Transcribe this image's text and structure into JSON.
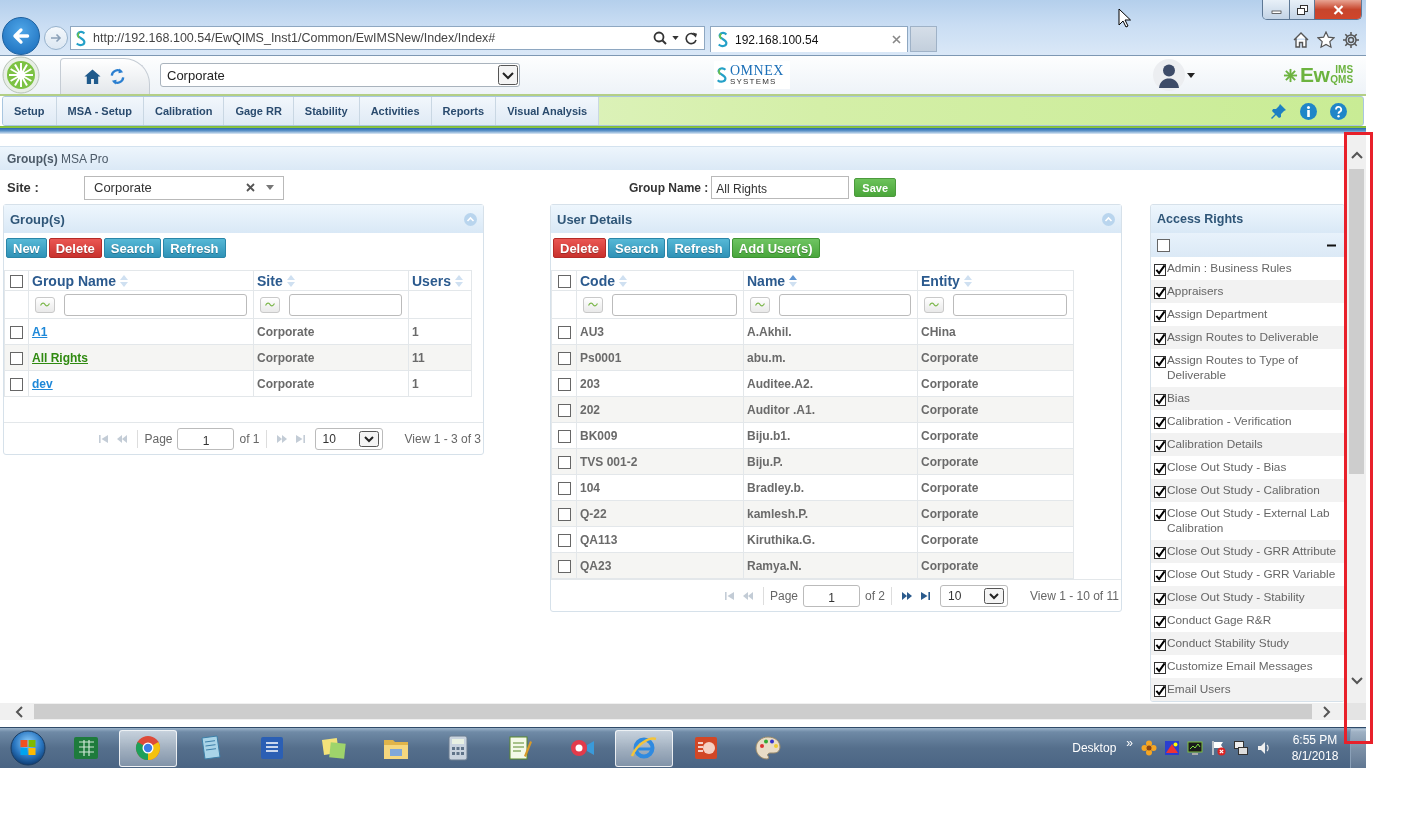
{
  "browser": {
    "url": "http://192.168.100.54/EwQIMS_Inst1/Common/EwIMSNew/Index/Index#",
    "tab_title": "192.168.100.54"
  },
  "app_header": {
    "site_select": "Corporate",
    "company_logo": {
      "name": "OMNEX",
      "tagline": "SYSTEMS"
    },
    "product_logo": {
      "main": "Ew",
      "top": "IMS",
      "bottom": "QMS"
    }
  },
  "menu": [
    "Setup",
    "MSA - Setup",
    "Calibration",
    "Gage RR",
    "Stability",
    "Activities",
    "Reports",
    "Visual Analysis"
  ],
  "page_title": "**Group(s)** MSA Pro",
  "site_filter": {
    "label": "Site :",
    "value": "Corporate"
  },
  "group_name": {
    "label": "Group Name :",
    "value": "All Rights",
    "save_button": "Save"
  },
  "groups_panel": {
    "title": "Group(s)",
    "buttons": [
      {
        "label": "New",
        "kind": "primary"
      },
      {
        "label": "Delete",
        "kind": "danger"
      },
      {
        "label": "Search",
        "kind": "primary"
      },
      {
        "label": "Refresh",
        "kind": "primary"
      }
    ],
    "all_checked": false,
    "columns": [
      {
        "label": "Group Name",
        "sorted": false,
        "filter": true
      },
      {
        "label": "Site",
        "sorted": false,
        "filter": true
      },
      {
        "label": "Users",
        "sorted": false,
        "filter": false
      }
    ],
    "rows": [
      {
        "name": "A1",
        "site": "Corporate",
        "users": "1",
        "checked": false,
        "selected": false
      },
      {
        "name": "All Rights",
        "site": "Corporate",
        "users": "11",
        "checked": false,
        "selected": true
      },
      {
        "name": "dev",
        "site": "Corporate",
        "users": "1",
        "checked": false,
        "selected": false
      }
    ],
    "pager": {
      "page_label": "Page",
      "page": "1",
      "total": "of 1",
      "page_size": "10",
      "summary": "View 1 - 3 of 3",
      "has_prev": false,
      "has_next": false
    }
  },
  "users_panel": {
    "title": "User Details",
    "buttons": [
      {
        "label": "Delete",
        "kind": "danger"
      },
      {
        "label": "Search",
        "kind": "primary"
      },
      {
        "label": "Refresh",
        "kind": "primary"
      },
      {
        "label": "Add User(s)",
        "kind": "success"
      }
    ],
    "all_checked": false,
    "columns": [
      {
        "label": "Code",
        "sorted": false,
        "filter": true
      },
      {
        "label": "Name",
        "sorted": true,
        "filter": true
      },
      {
        "label": "Entity",
        "sorted": false,
        "filter": true
      }
    ],
    "rows": [
      {
        "code": "AU3",
        "name": "A.Akhil.",
        "entity": "CHina",
        "checked": false
      },
      {
        "code": "Ps0001",
        "name": "abu.m.",
        "entity": "Corporate",
        "checked": false
      },
      {
        "code": "203",
        "name": "Auditee.A2.",
        "entity": "Corporate",
        "checked": false
      },
      {
        "code": "202",
        "name": "Auditor .A1.",
        "entity": "Corporate",
        "checked": false
      },
      {
        "code": "BK009",
        "name": "Biju.b1.",
        "entity": "Corporate",
        "checked": false
      },
      {
        "code": "TVS 001-2",
        "name": "Biju.P.",
        "entity": "Corporate",
        "checked": false
      },
      {
        "code": "104",
        "name": "Bradley.b.",
        "entity": "Corporate",
        "checked": false
      },
      {
        "code": "Q-22",
        "name": "kamlesh.P.",
        "entity": "Corporate",
        "checked": false
      },
      {
        "code": "QA113",
        "name": "Kiruthika.G.",
        "entity": "Corporate",
        "checked": false
      },
      {
        "code": "QA23",
        "name": "Ramya.N.",
        "entity": "Corporate",
        "checked": false
      }
    ],
    "pager": {
      "page_label": "Page",
      "page": "1",
      "total": "of 2",
      "page_size": "10",
      "summary": "View 1 - 10 of 11",
      "has_prev": false,
      "has_next": true
    }
  },
  "access_rights": {
    "title": "Access Rights",
    "all_checked": false,
    "expanded": true,
    "items": [
      {
        "label": "Admin : Business Rules",
        "checked": true
      },
      {
        "label": "Appraisers",
        "checked": true
      },
      {
        "label": "Assign Department",
        "checked": true
      },
      {
        "label": "Assign Routes to Deliverable",
        "checked": true
      },
      {
        "label": "Assign Routes to Type of Deliverable",
        "checked": true
      },
      {
        "label": "Bias",
        "checked": true
      },
      {
        "label": "Calibration - Verification",
        "checked": true
      },
      {
        "label": "Calibration Details",
        "checked": true
      },
      {
        "label": "Close Out Study - Bias",
        "checked": true
      },
      {
        "label": "Close Out Study - Calibration",
        "checked": true
      },
      {
        "label": "Close Out Study - External Lab Calibration",
        "checked": true
      },
      {
        "label": "Close Out Study - GRR Attribute",
        "checked": true
      },
      {
        "label": "Close Out Study - GRR Variable",
        "checked": true
      },
      {
        "label": "Close Out Study - Stability",
        "checked": true
      },
      {
        "label": "Conduct Gage R&R",
        "checked": true
      },
      {
        "label": "Conduct Stability Study",
        "checked": true
      },
      {
        "label": "Customize Email Messages",
        "checked": true
      },
      {
        "label": "Email Users",
        "checked": true
      }
    ]
  },
  "taskbar": {
    "apps": [
      {
        "kind": "spreadsheet",
        "active": false
      },
      {
        "kind": "browser",
        "active": true
      },
      {
        "kind": "notebook",
        "active": false
      },
      {
        "kind": "document",
        "active": false
      },
      {
        "kind": "notes",
        "active": false
      },
      {
        "kind": "folder",
        "active": false
      },
      {
        "kind": "calculator",
        "active": false
      },
      {
        "kind": "notepad",
        "active": false
      },
      {
        "kind": "camera",
        "active": false
      },
      {
        "kind": "web",
        "active": true
      },
      {
        "kind": "presentation",
        "active": false
      },
      {
        "kind": "paint",
        "active": false
      }
    ],
    "desktop_label": "Desktop",
    "overflow": "»",
    "time": "6:55 PM",
    "date": "8/1/2018"
  }
}
